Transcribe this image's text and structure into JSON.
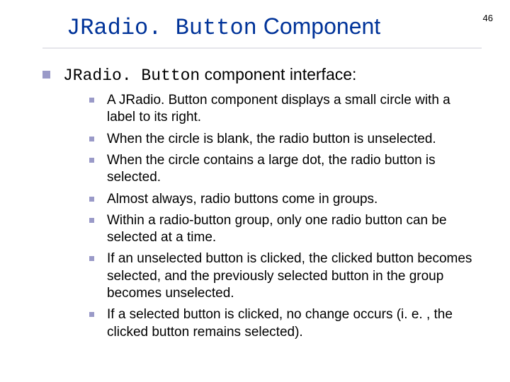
{
  "page_number": "46",
  "title_code": "JRadio. Button",
  "title_rest": " Component",
  "heading_code": "JRadio. Button",
  "heading_rest": " component interface:",
  "items": [
    "A JRadio. Button component displays a small circle with a label to its right.",
    "When the circle is blank, the radio button is unselected.",
    "When the circle contains a large dot, the radio button is selected.",
    "Almost always, radio buttons come in groups.",
    "Within a radio-button group, only one radio button can be selected at a time.",
    "If an unselected button is clicked, the clicked button becomes selected, and the previously selected button in the group becomes unselected.",
    "If a selected button is clicked, no change occurs (i. e. , the clicked button remains selected)."
  ]
}
